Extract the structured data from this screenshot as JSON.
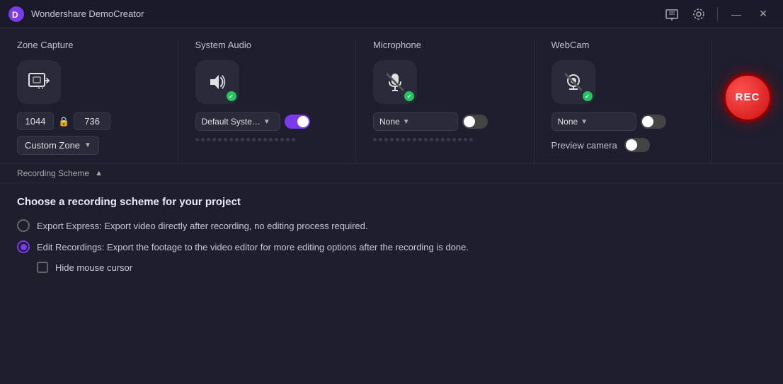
{
  "titleBar": {
    "appName": "Wondershare DemoCreator",
    "minimizeLabel": "—",
    "closeLabel": "✕"
  },
  "sections": {
    "zoneCapture": {
      "label": "Zone Capture",
      "width": "1044",
      "height": "736",
      "dropdown": "Custom Zone",
      "dropdownArrow": "▼"
    },
    "systemAudio": {
      "label": "System Audio",
      "dropdownValue": "Default Syste…",
      "dropdownArrow": "▼",
      "toggleOn": true,
      "dotsCount": 18
    },
    "microphone": {
      "label": "Microphone",
      "dropdownValue": "None",
      "dropdownArrow": "▼",
      "toggleOn": false,
      "dotsCount": 18
    },
    "webcam": {
      "label": "WebCam",
      "dropdownValue": "None",
      "dropdownArrow": "▼",
      "toggleOn": false,
      "previewLabel": "Preview camera"
    }
  },
  "recButton": {
    "label": "REC"
  },
  "recordingScheme": {
    "label": "Recording Scheme",
    "arrow": "▲"
  },
  "choosingSection": {
    "title": "Choose a recording scheme for your project",
    "option1": {
      "text": "Export Express: Export video directly after recording, no editing process required.",
      "selected": false
    },
    "option2": {
      "text": "Edit Recordings: Export the footage to the video editor for more editing options after the recording is done.",
      "selected": true
    },
    "checkbox": {
      "text": "Hide mouse cursor",
      "checked": false
    }
  }
}
